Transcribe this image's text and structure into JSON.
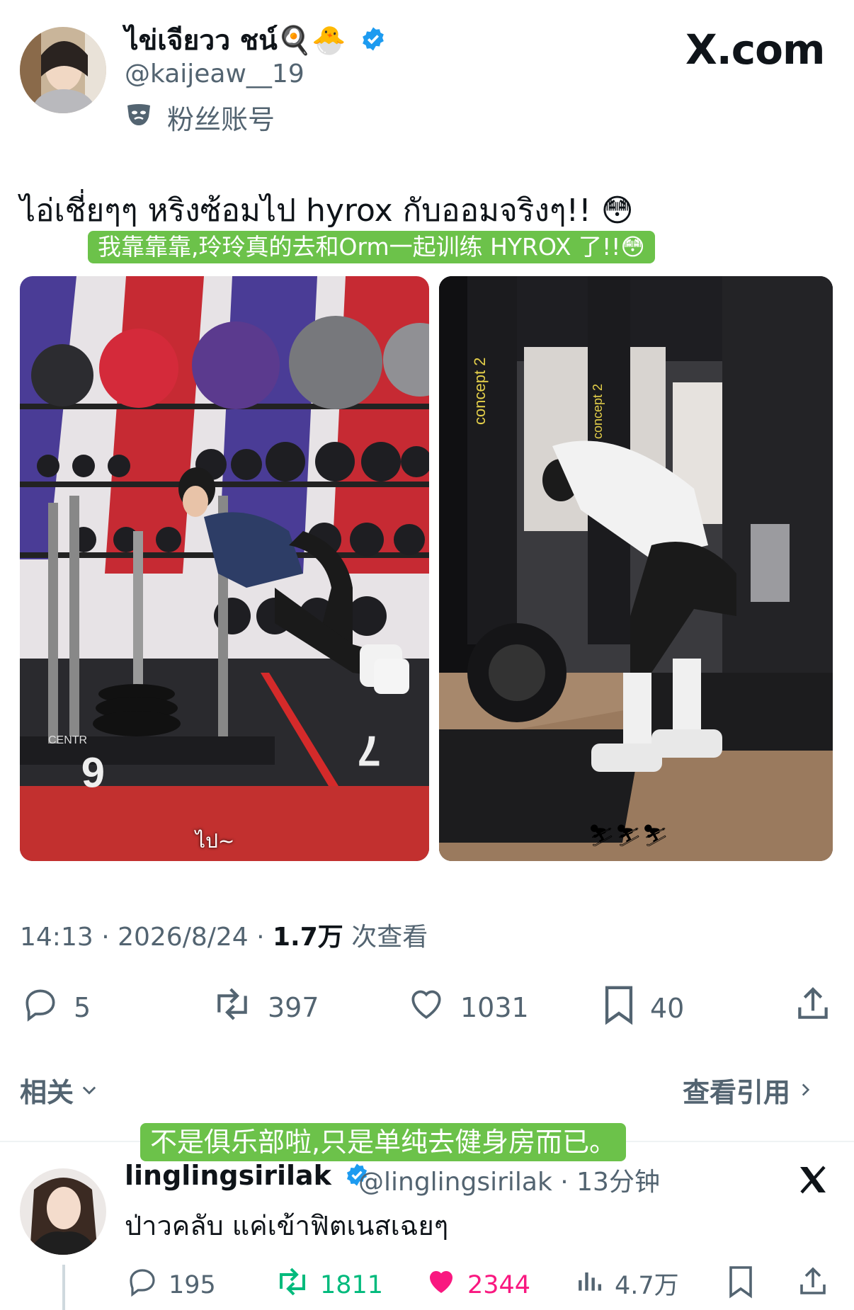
{
  "user": {
    "display_name": "ไข่เจียวว ชน์🍳🐣",
    "handle": "@kaijeaw__19",
    "fan_label": "粉丝账号"
  },
  "brand": {
    "logo_text": "X.com"
  },
  "tweet": {
    "text": "ไอ่เชี่ยๆๆ หริงซ้อมไป hyrox กับออมจริงๆ!! 😳",
    "translation": "我靠靠靠,玲玲真的去和Orm一起训练 HYROX 了!!😳",
    "photo1_caption": "ไป~"
  },
  "meta": {
    "timestamp": "14:13 · 2026/8/24 · ",
    "views": "1.7万",
    "views_label": " 次查看"
  },
  "actions": {
    "replies": "5",
    "retweets": "397",
    "likes": "1031",
    "bookmarks": "40"
  },
  "links": {
    "related": "相关",
    "quotes": "查看引用"
  },
  "reply_translation": "不是俱乐部啦,只是单纯去健身房而已。",
  "reply": {
    "name": "linglingsirilak",
    "handle_time": "@linglingsirilak · 13分钟",
    "text": "ป่าวคลับ แค่เข้าฟิตเนสเฉยๆ",
    "replies": "195",
    "retweets": "1811",
    "likes": "2344",
    "views": "4.7万"
  },
  "colors": {
    "text": "#0f1419",
    "secondary": "#536471",
    "verified": "#1d9bf0",
    "retweet_green": "#00ba7c",
    "like_pink": "#f91880",
    "subtitle_green": "#6cc24a"
  },
  "icons": [
    "verified-badge-icon",
    "fan-account-mask-icon",
    "x-logo-icon",
    "reply-icon",
    "retweet-icon",
    "like-icon",
    "bookmark-icon",
    "share-icon",
    "chevron-down-icon",
    "chevron-right-icon",
    "views-icon"
  ]
}
